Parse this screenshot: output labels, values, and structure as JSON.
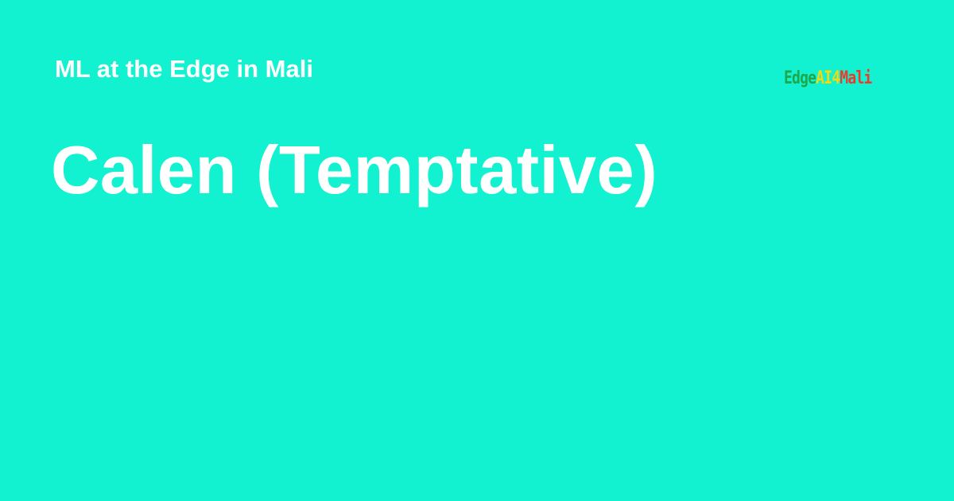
{
  "colors": {
    "background": "#12f2d0",
    "text": "#ffffff",
    "logo_green": "#1fa84a",
    "logo_yellow": "#f5d90a",
    "logo_red": "#ee3a2d"
  },
  "header": {
    "site_name": "ML at the Edge in Mali"
  },
  "main": {
    "title": "Calen (Temptative)"
  },
  "logo": {
    "part_1": "Edge",
    "part_2": "AI",
    "part_3": "4",
    "part_4": "Mali"
  }
}
